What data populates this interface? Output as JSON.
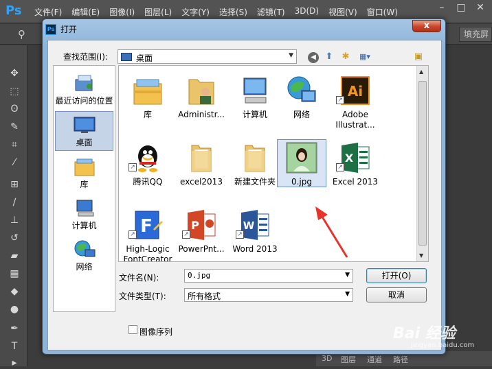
{
  "ps": {
    "logo": "Ps",
    "menu": [
      "文件(F)",
      "编辑(E)",
      "图像(I)",
      "图层(L)",
      "文字(Y)",
      "选择(S)",
      "滤镜(T)",
      "3D(D)",
      "视图(V)",
      "窗口(W)"
    ],
    "fill_button": "填充屏",
    "bottom_tabs": [
      "3D",
      "图层",
      "通道",
      "路径"
    ]
  },
  "dialog": {
    "title": "打开",
    "close_label": "x",
    "look_in_label": "查找范围(I):",
    "look_in_value": "桌面",
    "places": [
      {
        "label": "最近访问的位置",
        "icon": "recent-places-icon"
      },
      {
        "label": "桌面",
        "icon": "desktop-icon",
        "selected": true
      },
      {
        "label": "库",
        "icon": "library-icon"
      },
      {
        "label": "计算机",
        "icon": "computer-icon"
      },
      {
        "label": "网络",
        "icon": "network-icon"
      }
    ],
    "files": [
      {
        "label": "库",
        "icon": "library-icon"
      },
      {
        "label": "Administr...",
        "icon": "user-folder-icon"
      },
      {
        "label": "计算机",
        "icon": "computer-icon"
      },
      {
        "label": "网络",
        "icon": "network-icon"
      },
      {
        "label": "Adobe Illustrat...",
        "icon": "illustrator-icon"
      },
      {
        "label": "腾讯QQ",
        "icon": "qq-icon"
      },
      {
        "label": "excel2013",
        "icon": "folder-icon"
      },
      {
        "label": "新建文件夹",
        "icon": "folder-icon"
      },
      {
        "label": "0.jpg",
        "icon": "image-thumbnail-icon",
        "selected": true
      },
      {
        "label": "Excel 2013",
        "icon": "excel-icon"
      },
      {
        "label": "High-Logic FontCreator",
        "icon": "fontcreator-icon"
      },
      {
        "label": "PowerPnt...",
        "icon": "powerpoint-icon"
      },
      {
        "label": "Word 2013",
        "icon": "word-icon"
      }
    ],
    "filename_label": "文件名(N):",
    "filename_value": "0.jpg",
    "filetype_label": "文件类型(T):",
    "filetype_value": "所有格式",
    "open_button": "打开(O)",
    "cancel_button": "取消",
    "image_sequence_label": "图像序列"
  },
  "watermark": {
    "text": "Bai 经验",
    "sub": "jingyan.baidu.com"
  }
}
